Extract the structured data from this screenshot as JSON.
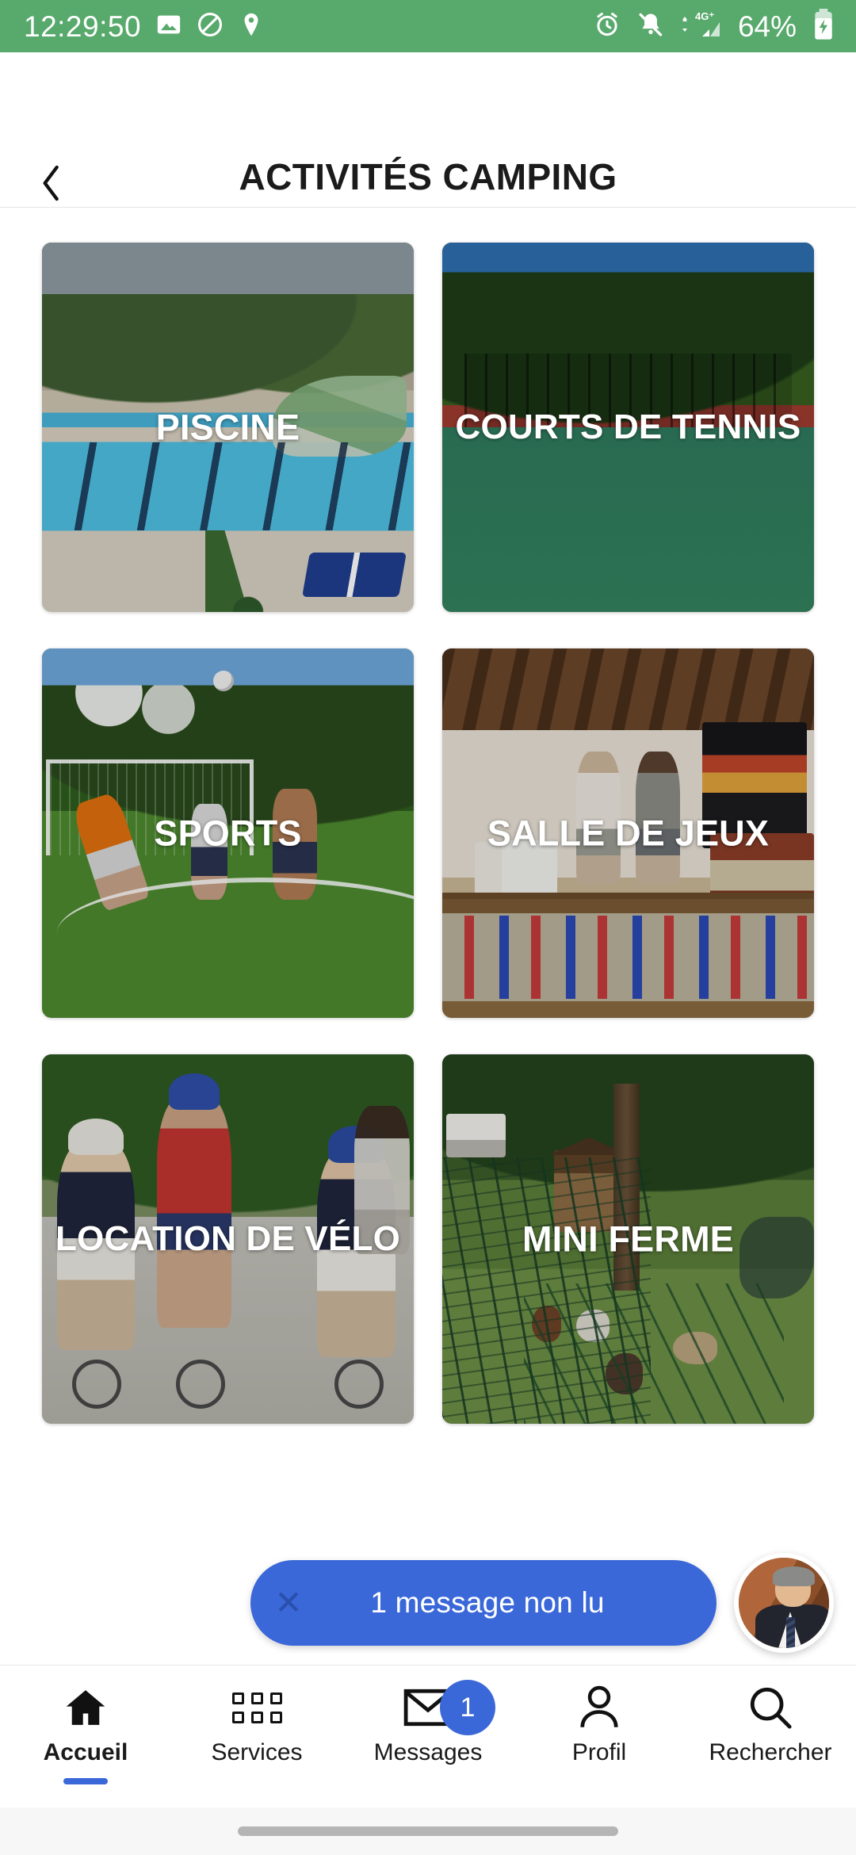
{
  "status_bar": {
    "clock": "12:29:50",
    "battery_percent": "64%",
    "network": "4G+",
    "background_color": "#58a96c",
    "left_icons": [
      "image-icon",
      "do-not-disturb-icon",
      "location-pin-icon"
    ],
    "right_icons": [
      "alarm-clock-icon",
      "notifications-muted-icon",
      "signal-4g-icon",
      "battery-charging-icon"
    ]
  },
  "app_bar": {
    "title": "ACTIVITÉS CAMPING",
    "back_icon": "chevron-left-icon"
  },
  "activities": [
    {
      "label": "PISCINE",
      "photo": "swimming-pool"
    },
    {
      "label": "COURTS DE TENNIS",
      "photo": "tennis-court"
    },
    {
      "label": "SPORTS",
      "photo": "football-pitch"
    },
    {
      "label": "SALLE DE JEUX",
      "photo": "games-room"
    },
    {
      "label": "LOCATION DE VÉLO",
      "photo": "family-cycling"
    },
    {
      "label": "MINI FERME",
      "photo": "mini-farm"
    }
  ],
  "message_bar": {
    "text": "1 message non lu",
    "close_glyph": "✕",
    "accent_color": "#3b68d8",
    "avatar": "staff-avatar"
  },
  "bottom_nav": {
    "items": [
      {
        "label": "Accueil",
        "icon": "home-icon",
        "active": true,
        "badge": ""
      },
      {
        "label": "Services",
        "icon": "grid-icon",
        "active": false,
        "badge": ""
      },
      {
        "label": "Messages",
        "icon": "envelope-icon",
        "active": false,
        "badge": "1"
      },
      {
        "label": "Profil",
        "icon": "person-icon",
        "active": false,
        "badge": ""
      },
      {
        "label": "Rechercher",
        "icon": "search-icon",
        "active": false,
        "badge": ""
      }
    ],
    "active_indicator_color": "#3b68d8"
  }
}
